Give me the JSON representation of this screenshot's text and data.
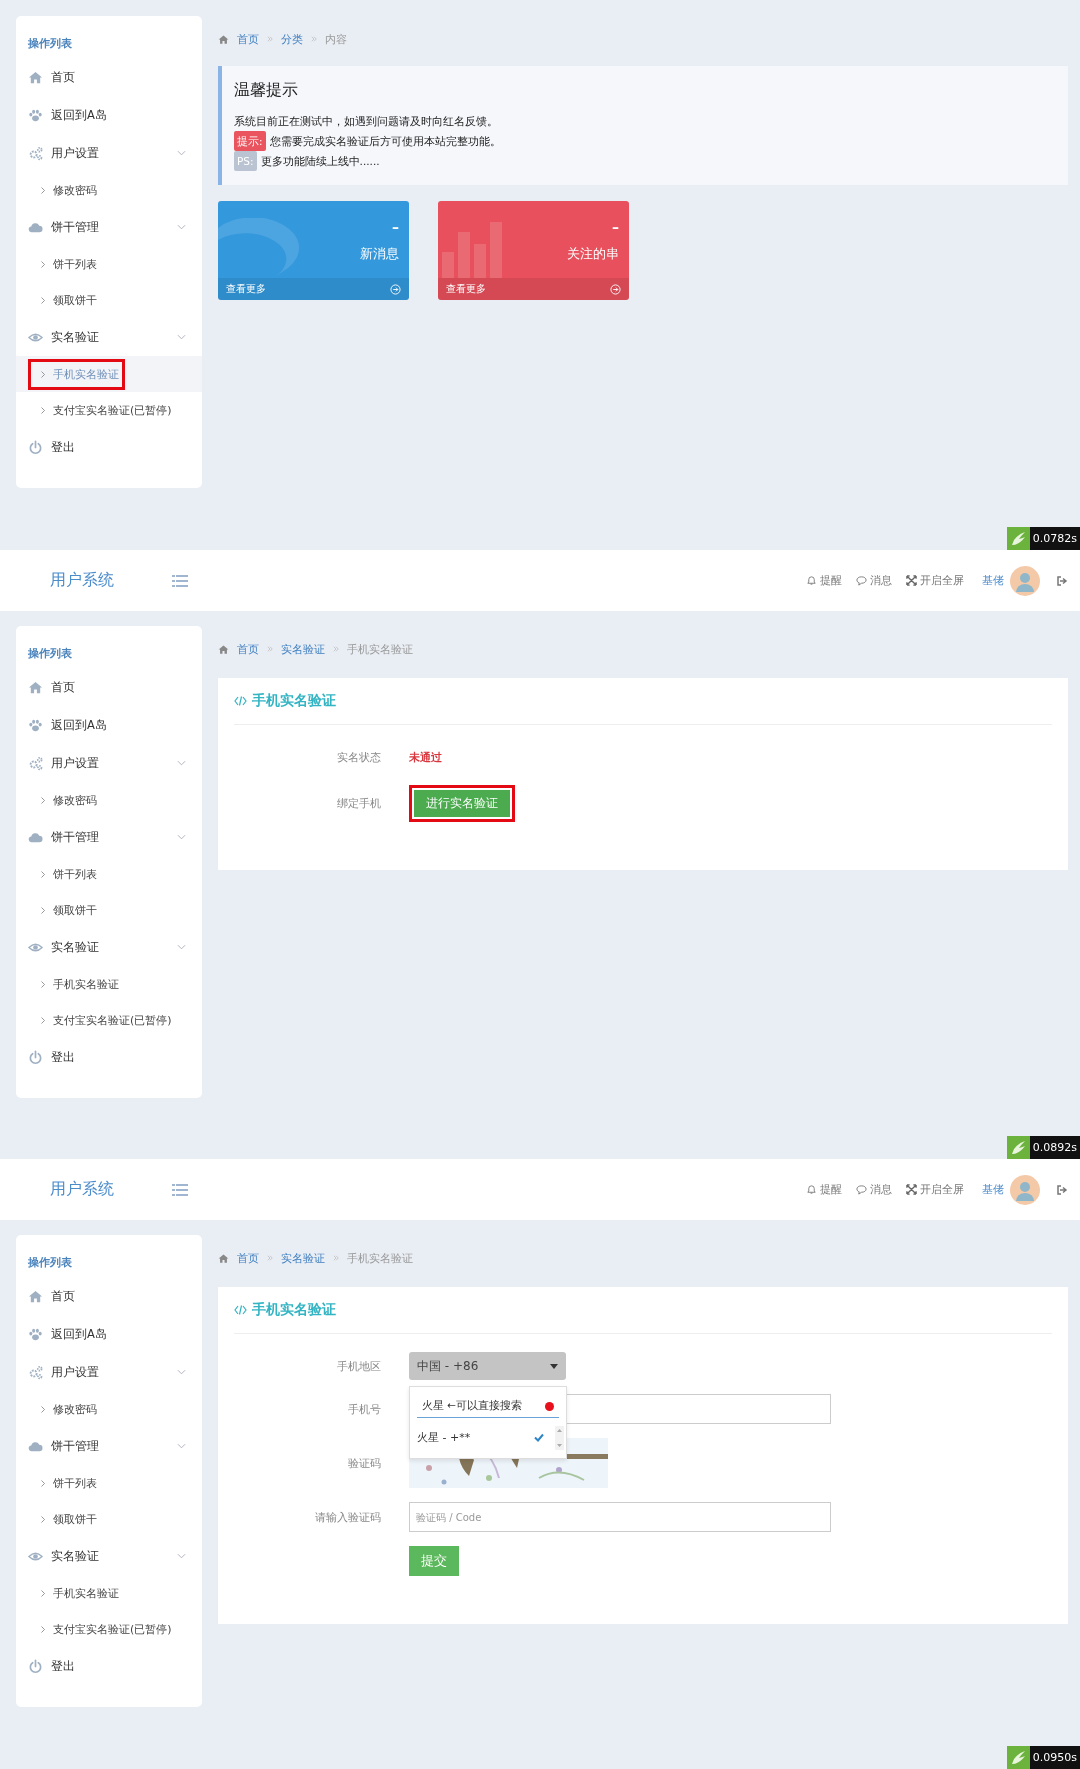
{
  "screens": [
    {
      "kind": "dashboard",
      "timing": "0.0782s",
      "sidebar": {
        "title": "操作列表",
        "items": [
          {
            "label": "首页",
            "expanded": false
          },
          {
            "label": "返回到A岛",
            "expanded": false
          },
          {
            "label": "用户设置",
            "expanded": true,
            "children": [
              {
                "label": "修改密码",
                "selected": false,
                "highlighted": false
              }
            ]
          },
          {
            "label": "饼干管理",
            "expanded": true,
            "children": [
              {
                "label": "饼干列表",
                "selected": false,
                "highlighted": false
              },
              {
                "label": "领取饼干",
                "selected": false,
                "highlighted": false
              }
            ]
          },
          {
            "label": "实名验证",
            "expanded": true,
            "children": [
              {
                "label": "手机实名验证",
                "selected": true,
                "highlighted": true
              },
              {
                "label": "支付宝实名验证(已暂停)",
                "selected": false,
                "highlighted": false
              }
            ]
          },
          {
            "label": "登出",
            "expanded": false
          }
        ]
      },
      "breadcrumb": [
        {
          "label": "首页",
          "current": false
        },
        {
          "label": "分类",
          "current": false
        },
        {
          "label": "内容",
          "current": true
        }
      ],
      "notice": {
        "title": "温馨提示",
        "lines": [
          {
            "text": "系统目前正在测试中，如遇到问题请及时向红名反馈。"
          },
          {
            "tag": "提示:",
            "color": "#e9545e",
            "text": "您需要完成实名验证后方可使用本站完整功能。"
          },
          {
            "tag": "PS:",
            "color": "#b9c3d1",
            "text": "更多功能陆续上线中......"
          }
        ]
      },
      "tiles": [
        {
          "value": "–",
          "label": "新消息",
          "link": "查看更多",
          "color": "#3498dc"
        },
        {
          "value": "–",
          "label": "关注的串",
          "link": "查看更多",
          "color": "#e7505c"
        }
      ]
    },
    {
      "kind": "status",
      "timing": "0.0892s",
      "header": {
        "brand": "用户系统",
        "actions": [
          {
            "label": "提醒"
          },
          {
            "label": "消息"
          },
          {
            "label": "开启全屏"
          }
        ],
        "user": "基佬"
      },
      "sidebar": {
        "title": "操作列表",
        "items": [
          {
            "label": "首页",
            "expanded": false
          },
          {
            "label": "返回到A岛",
            "expanded": false
          },
          {
            "label": "用户设置",
            "expanded": true,
            "children": [
              {
                "label": "修改密码",
                "selected": false,
                "highlighted": false
              }
            ]
          },
          {
            "label": "饼干管理",
            "expanded": true,
            "children": [
              {
                "label": "饼干列表",
                "selected": false,
                "highlighted": false
              },
              {
                "label": "领取饼干",
                "selected": false,
                "highlighted": false
              }
            ]
          },
          {
            "label": "实名验证",
            "expanded": true,
            "children": [
              {
                "label": "手机实名验证",
                "selected": false,
                "highlighted": false
              },
              {
                "label": "支付宝实名验证(已暂停)",
                "selected": false,
                "highlighted": false
              }
            ]
          },
          {
            "label": "登出",
            "expanded": false
          }
        ]
      },
      "breadcrumb": [
        {
          "label": "首页",
          "current": false
        },
        {
          "label": "实名验证",
          "current": false
        },
        {
          "label": "手机实名验证",
          "current": true
        }
      ],
      "card": {
        "title": "手机实名验证",
        "rows": [
          {
            "kind": "status",
            "label": "实名状态",
            "value": "未通过"
          },
          {
            "kind": "button",
            "label": "绑定手机",
            "value": "进行实名验证",
            "highlighted": true
          }
        ]
      }
    },
    {
      "kind": "form",
      "timing": "0.0950s",
      "header": {
        "brand": "用户系统",
        "actions": [
          {
            "label": "提醒"
          },
          {
            "label": "消息"
          },
          {
            "label": "开启全屏"
          }
        ],
        "user": "基佬"
      },
      "sidebar": {
        "title": "操作列表",
        "items": [
          {
            "label": "首页",
            "expanded": false
          },
          {
            "label": "返回到A岛",
            "expanded": false
          },
          {
            "label": "用户设置",
            "expanded": true,
            "children": [
              {
                "label": "修改密码",
                "selected": false,
                "highlighted": false
              }
            ]
          },
          {
            "label": "饼干管理",
            "expanded": true,
            "children": [
              {
                "label": "饼干列表",
                "selected": false,
                "highlighted": false
              },
              {
                "label": "领取饼干",
                "selected": false,
                "highlighted": false
              }
            ]
          },
          {
            "label": "实名验证",
            "expanded": true,
            "children": [
              {
                "label": "手机实名验证",
                "selected": false,
                "highlighted": false
              },
              {
                "label": "支付宝实名验证(已暂停)",
                "selected": false,
                "highlighted": false
              }
            ]
          },
          {
            "label": "登出",
            "expanded": false
          }
        ]
      },
      "breadcrumb": [
        {
          "label": "首页",
          "current": false
        },
        {
          "label": "实名验证",
          "current": false
        },
        {
          "label": "手机实名验证",
          "current": true
        }
      ],
      "card": {
        "title": "手机实名验证",
        "rows": [
          {
            "kind": "select",
            "label": "手机地区",
            "value": "中国 - +86",
            "expanded": true,
            "search": "火星 ←可以直接搜索",
            "options": [
              {
                "label": "火星 - +**",
                "selected": true
              }
            ]
          },
          {
            "kind": "input",
            "label": "手机号"
          },
          {
            "kind": "captcha",
            "label": "验证码"
          },
          {
            "kind": "input",
            "label": "请输入验证码",
            "placeholder": "验证码 / Code"
          },
          {
            "kind": "submit",
            "value": "提交"
          }
        ]
      }
    }
  ]
}
